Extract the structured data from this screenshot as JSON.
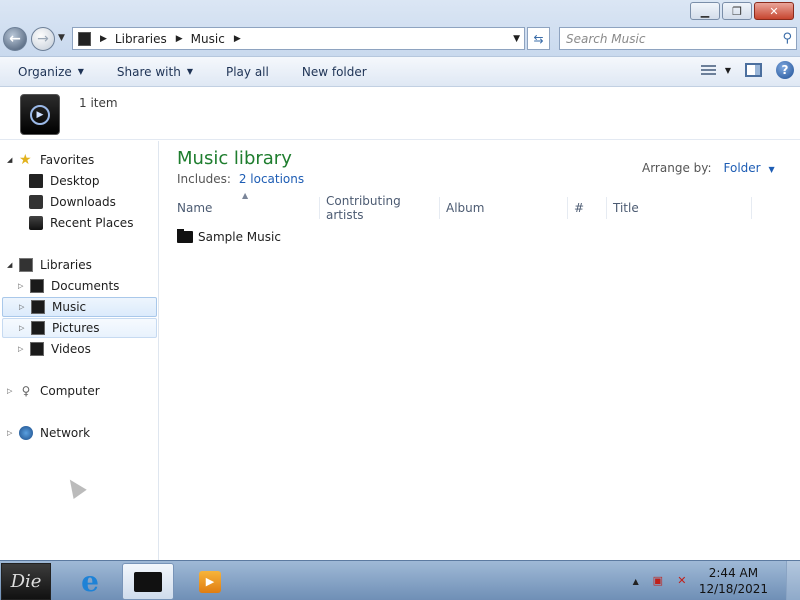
{
  "window": {
    "minimize_icon": "minimize-icon",
    "maximize_icon": "restore-icon",
    "close_icon": "close-icon"
  },
  "address": {
    "crumbs": [
      "Libraries",
      "Music"
    ],
    "search_placeholder": "Search Music"
  },
  "toolbar": {
    "organize": "Organize",
    "share_with": "Share with",
    "play_all": "Play all",
    "new_folder": "New folder"
  },
  "details": {
    "item_count": "1 item"
  },
  "sidebar": {
    "favorites": "Favorites",
    "desktop": "Desktop",
    "downloads": "Downloads",
    "recent_places": "Recent Places",
    "libraries": "Libraries",
    "documents": "Documents",
    "music": "Music",
    "pictures": "Pictures",
    "videos": "Videos",
    "computer": "Computer",
    "network": "Network"
  },
  "main": {
    "title": "Music library",
    "includes_label": "Includes:",
    "includes_link": "2 locations",
    "arrange_label": "Arrange by:",
    "arrange_value": "Folder",
    "columns": [
      "Name",
      "Contributing artists",
      "Album",
      "#",
      "Title"
    ],
    "items": [
      {
        "name": "Sample Music"
      }
    ]
  },
  "taskbar": {
    "start_label": "Die",
    "time": "2:44 AM",
    "date": "12/18/2021"
  },
  "colors": {
    "library_title": "#1e7d2e",
    "link": "#1e5db4",
    "selection": "#dcebfc"
  }
}
